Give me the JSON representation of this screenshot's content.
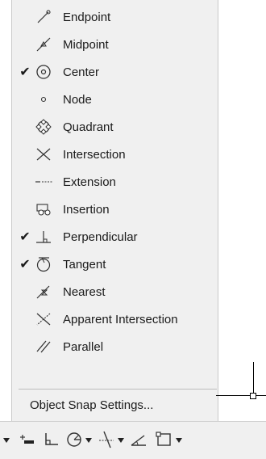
{
  "menu": {
    "items": [
      {
        "label": "Endpoint",
        "checked": false,
        "icon": "endpoint-icon"
      },
      {
        "label": "Midpoint",
        "checked": false,
        "icon": "midpoint-icon"
      },
      {
        "label": "Center",
        "checked": true,
        "icon": "center-icon"
      },
      {
        "label": "Node",
        "checked": false,
        "icon": "node-icon"
      },
      {
        "label": "Quadrant",
        "checked": false,
        "icon": "quadrant-icon"
      },
      {
        "label": "Intersection",
        "checked": false,
        "icon": "intersection-icon"
      },
      {
        "label": "Extension",
        "checked": false,
        "icon": "extension-icon"
      },
      {
        "label": "Insertion",
        "checked": false,
        "icon": "insertion-icon"
      },
      {
        "label": "Perpendicular",
        "checked": true,
        "icon": "perpendicular-icon"
      },
      {
        "label": "Tangent",
        "checked": true,
        "icon": "tangent-icon"
      },
      {
        "label": "Nearest",
        "checked": false,
        "icon": "nearest-icon"
      },
      {
        "label": "Apparent Intersection",
        "checked": false,
        "icon": "apparent-intersection-icon"
      },
      {
        "label": "Parallel",
        "checked": false,
        "icon": "parallel-icon"
      }
    ],
    "check_glyph": "✔",
    "settings_label": "Object Snap Settings..."
  },
  "statusbar": {
    "icons": [
      "dropdown-arrow-icon",
      "dynamic-ucs-icon",
      "ortho-icon",
      "polar-tracking-icon",
      "object-snap-tracking-icon",
      "isodraft-icon",
      "object-snap-icon"
    ]
  }
}
